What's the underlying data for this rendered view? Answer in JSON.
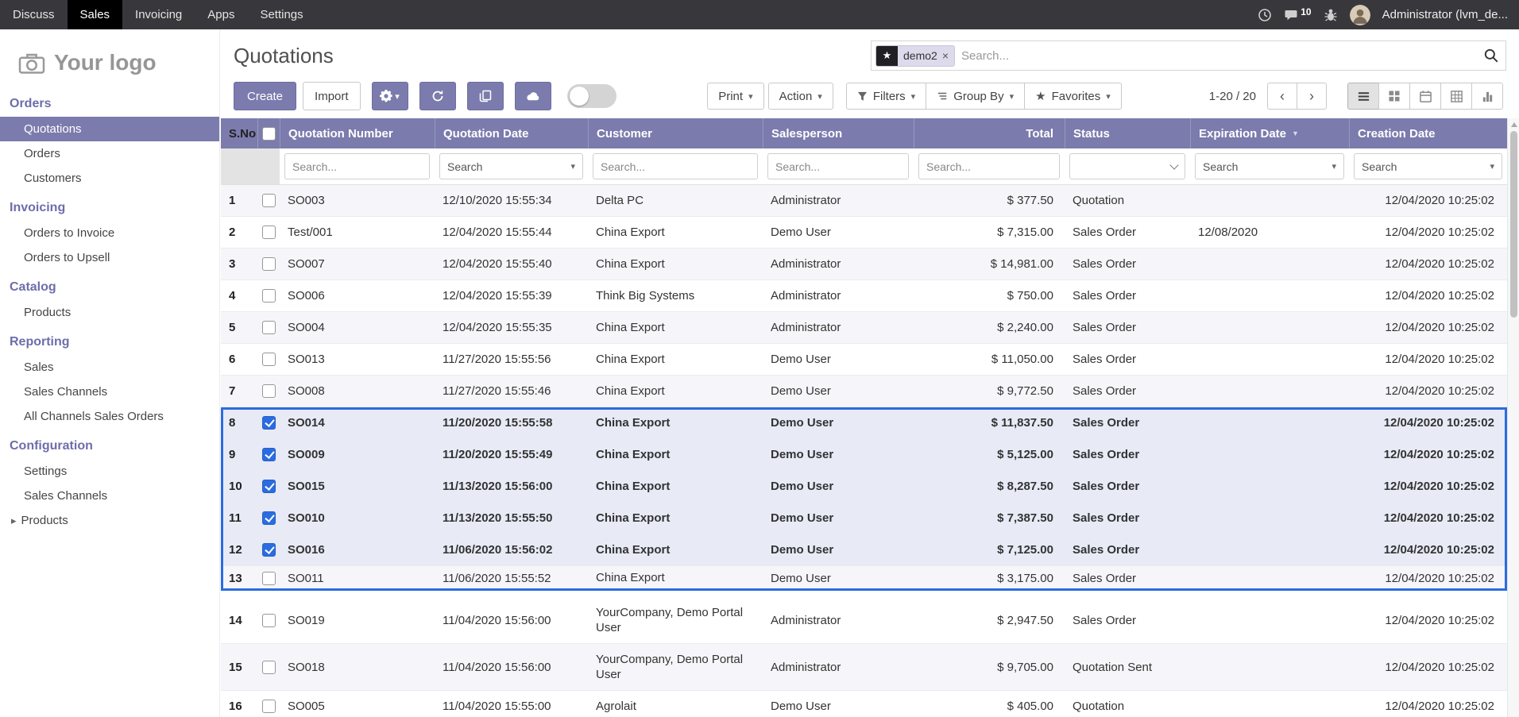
{
  "icons": {
    "star": "★",
    "caret_down": "▾",
    "chevron_left": "‹",
    "chevron_right": "›",
    "expand_caret": "▸",
    "close": "×",
    "sort_desc": "▼"
  },
  "colors": {
    "accent_purple": "#7c7bad",
    "selection_blue": "#2b6ce0",
    "topbar_black": "#38383c"
  },
  "topbar": {
    "menus": [
      {
        "label": "Discuss"
      },
      {
        "label": "Sales",
        "active": true
      },
      {
        "label": "Invoicing"
      },
      {
        "label": "Apps"
      },
      {
        "label": "Settings"
      }
    ],
    "messages_badge": "10",
    "user_name": "Administrator (lvm_de..."
  },
  "sidebar": {
    "logo_text": "Your logo",
    "orders": {
      "title": "Orders",
      "items": [
        {
          "label": "Quotations",
          "active": true
        },
        {
          "label": "Orders"
        },
        {
          "label": "Customers"
        }
      ]
    },
    "invoicing": {
      "title": "Invoicing",
      "items": [
        {
          "label": "Orders to Invoice"
        },
        {
          "label": "Orders to Upsell"
        }
      ]
    },
    "catalog": {
      "title": "Catalog",
      "items": [
        {
          "label": "Products"
        }
      ]
    },
    "reporting": {
      "title": "Reporting",
      "items": [
        {
          "label": "Sales"
        },
        {
          "label": "Sales Channels"
        },
        {
          "label": "All Channels Sales Orders"
        }
      ]
    },
    "configuration": {
      "title": "Configuration",
      "items": [
        {
          "label": "Settings"
        },
        {
          "label": "Sales Channels"
        },
        {
          "label": "Products",
          "expandable": true
        }
      ]
    }
  },
  "page": {
    "title": "Quotations",
    "search_facet": "demo2",
    "search_placeholder": "Search..."
  },
  "toolbar": {
    "create_label": "Create",
    "import_label": "Import",
    "print_label": "Print",
    "action_label": "Action",
    "filters_label": "Filters",
    "group_by_label": "Group By",
    "favorites_label": "Favorites",
    "pager": "1-20 / 20"
  },
  "table": {
    "headers": {
      "sno": "S.No",
      "number": "Quotation Number",
      "date": "Quotation Date",
      "customer": "Customer",
      "salesperson": "Salesperson",
      "total": "Total",
      "status": "Status",
      "expiration": "Expiration Date",
      "creation": "Creation Date"
    },
    "filters": {
      "search_placeholder": "Search...",
      "combo_placeholder": "Search"
    },
    "rows_top": [
      {
        "n": "1",
        "number": "SO003",
        "date": "12/10/2020 15:55:34",
        "customer": "Delta PC",
        "salesperson": "Administrator",
        "total": "$ 377.50",
        "status": "Quotation",
        "expiration": "",
        "creation": "12/04/2020 10:25:02"
      },
      {
        "n": "2",
        "number": "Test/001",
        "date": "12/04/2020 15:55:44",
        "customer": "China Export",
        "salesperson": "Demo User",
        "total": "$ 7,315.00",
        "status": "Sales Order",
        "expiration": "12/08/2020",
        "creation": "12/04/2020 10:25:02"
      },
      {
        "n": "3",
        "number": "SO007",
        "date": "12/04/2020 15:55:40",
        "customer": "China Export",
        "salesperson": "Administrator",
        "total": "$ 14,981.00",
        "status": "Sales Order",
        "expiration": "",
        "creation": "12/04/2020 10:25:02"
      },
      {
        "n": "4",
        "number": "SO006",
        "date": "12/04/2020 15:55:39",
        "customer": "Think Big Systems",
        "salesperson": "Administrator",
        "total": "$ 750.00",
        "status": "Sales Order",
        "expiration": "",
        "creation": "12/04/2020 10:25:02"
      },
      {
        "n": "5",
        "number": "SO004",
        "date": "12/04/2020 15:55:35",
        "customer": "China Export",
        "salesperson": "Administrator",
        "total": "$ 2,240.00",
        "status": "Sales Order",
        "expiration": "",
        "creation": "12/04/2020 10:25:02"
      },
      {
        "n": "6",
        "number": "SO013",
        "date": "11/27/2020 15:55:56",
        "customer": "China Export",
        "salesperson": "Demo User",
        "total": "$ 11,050.00",
        "status": "Sales Order",
        "expiration": "",
        "creation": "12/04/2020 10:25:02"
      },
      {
        "n": "7",
        "number": "SO008",
        "date": "11/27/2020 15:55:46",
        "customer": "China Export",
        "salesperson": "Demo User",
        "total": "$ 9,772.50",
        "status": "Sales Order",
        "expiration": "",
        "creation": "12/04/2020 10:25:02"
      }
    ],
    "rows_selected": [
      {
        "n": "8",
        "number": "SO014",
        "date": "11/20/2020 15:55:58",
        "customer": "China Export",
        "salesperson": "Demo User",
        "total": "$ 11,837.50",
        "status": "Sales Order",
        "expiration": "",
        "creation": "12/04/2020 10:25:02",
        "checked": true
      },
      {
        "n": "9",
        "number": "SO009",
        "date": "11/20/2020 15:55:49",
        "customer": "China Export",
        "salesperson": "Demo User",
        "total": "$ 5,125.00",
        "status": "Sales Order",
        "expiration": "",
        "creation": "12/04/2020 10:25:02",
        "checked": true
      },
      {
        "n": "10",
        "number": "SO015",
        "date": "11/13/2020 15:56:00",
        "customer": "China Export",
        "salesperson": "Demo User",
        "total": "$ 8,287.50",
        "status": "Sales Order",
        "expiration": "",
        "creation": "12/04/2020 10:25:02",
        "checked": true
      },
      {
        "n": "11",
        "number": "SO010",
        "date": "11/13/2020 15:55:50",
        "customer": "China Export",
        "salesperson": "Demo User",
        "total": "$ 7,387.50",
        "status": "Sales Order",
        "expiration": "",
        "creation": "12/04/2020 10:25:02",
        "checked": true
      },
      {
        "n": "12",
        "number": "SO016",
        "date": "11/06/2020 15:56:02",
        "customer": "China Export",
        "salesperson": "Demo User",
        "total": "$ 7,125.00",
        "status": "Sales Order",
        "expiration": "",
        "creation": "12/04/2020 10:25:02",
        "checked": true
      },
      {
        "n": "13",
        "number": "SO011",
        "date": "11/06/2020 15:55:52",
        "customer": "China Export",
        "salesperson": "Demo User",
        "total": "$ 3,175.00",
        "status": "Sales Order",
        "expiration": "",
        "creation": "12/04/2020 10:25:02",
        "clipped": true
      }
    ],
    "rows_bottom": [
      {
        "n": "14",
        "number": "SO019",
        "date": "11/04/2020 15:56:00",
        "customer": "YourCompany, Demo Portal User",
        "salesperson": "Administrator",
        "total": "$ 2,947.50",
        "status": "Sales Order",
        "expiration": "",
        "creation": "12/04/2020 10:25:02",
        "tall": true
      },
      {
        "n": "15",
        "number": "SO018",
        "date": "11/04/2020 15:56:00",
        "customer": "YourCompany, Demo Portal User",
        "salesperson": "Administrator",
        "total": "$ 9,705.00",
        "status": "Quotation Sent",
        "expiration": "",
        "creation": "12/04/2020 10:25:02",
        "tall": true
      },
      {
        "n": "16",
        "number": "SO005",
        "date": "11/04/2020 15:55:00",
        "customer": "Agrolait",
        "salesperson": "Demo User",
        "total": "$ 405.00",
        "status": "Quotation",
        "expiration": "",
        "creation": "12/04/2020 10:25:02"
      }
    ]
  }
}
